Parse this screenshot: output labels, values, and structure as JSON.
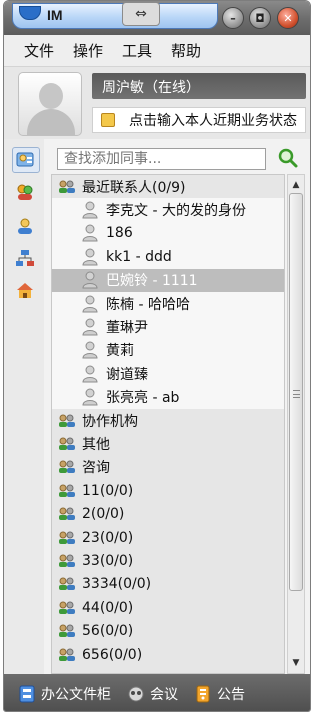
{
  "app": {
    "title": "IM",
    "resize_glyph": "⇔"
  },
  "window_controls": {
    "minimize": "–",
    "restore": "◘",
    "close": "✕"
  },
  "menu": {
    "items": [
      "文件",
      "操作",
      "工具",
      "帮助"
    ]
  },
  "profile": {
    "name_status": "周沪敏（在线）",
    "signature_placeholder": "点击输入本人近期业务状态"
  },
  "search": {
    "placeholder": "查找添加同事..."
  },
  "rail_icons": [
    "contacts-card-icon",
    "people-group-icon",
    "person-profile-icon",
    "org-chart-icon",
    "home-icon"
  ],
  "contacts": {
    "recent_group": "最近联系人(0/9)",
    "recent": [
      "李克文 - 大的发的身份",
      "186",
      "kk1 - ddd",
      "巴婉铃 - 1111",
      "陈楠 - 哈哈哈",
      "董琳尹",
      "黄莉",
      "谢道臻",
      "张亮亮 - ab"
    ],
    "selected_index": 3,
    "groups": [
      "协作机构",
      "其他",
      "咨询",
      "11(0/0)",
      "2(0/0)",
      "23(0/0)",
      "33(0/0)",
      "3334(0/0)",
      "44(0/0)",
      "56(0/0)",
      "656(0/0)"
    ]
  },
  "bottom": {
    "items": [
      "办公文件柜",
      "会议",
      "公告"
    ]
  },
  "colors": {
    "title_tab": "#b9d6f7",
    "chrome_dark": "#5e5e5e",
    "list_bg": "#e6e6e6",
    "selected_row": "#bdbdbd"
  }
}
